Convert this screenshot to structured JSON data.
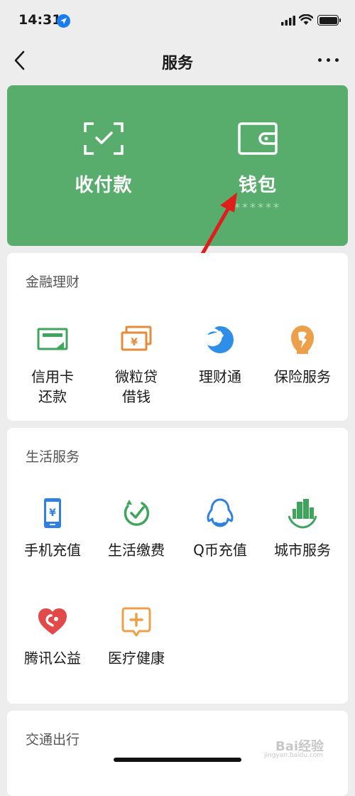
{
  "status_bar": {
    "time": "14:31"
  },
  "nav": {
    "title": "服务",
    "back_icon": "chevron-left-icon",
    "more_icon": "more-dots-icon"
  },
  "wallet_card": {
    "background": "#58ad6c",
    "items": [
      {
        "label": "收付款",
        "icon": "scan-check-icon"
      },
      {
        "label": "钱包",
        "sub": "******",
        "icon": "wallet-icon"
      }
    ]
  },
  "finance": {
    "title": "金融理财",
    "items": [
      {
        "label": "信用卡\n还款",
        "icon": "credit-card-icon"
      },
      {
        "label": "微粒贷\n借钱",
        "icon": "yuan-bills-icon"
      },
      {
        "label": "理财通",
        "icon": "licaitong-icon"
      },
      {
        "label": "保险服务",
        "icon": "insurance-umbrella-icon"
      }
    ]
  },
  "life": {
    "title": "生活服务",
    "items": [
      {
        "label": "手机充值",
        "icon": "phone-yuan-icon"
      },
      {
        "label": "生活缴费",
        "icon": "check-leaf-icon"
      },
      {
        "label": "Q币充值",
        "icon": "penguin-icon"
      },
      {
        "label": "城市服务",
        "icon": "city-buildings-icon"
      },
      {
        "label": "腾讯公益",
        "icon": "heart-icon"
      },
      {
        "label": "医疗健康",
        "icon": "medical-plus-icon"
      }
    ]
  },
  "transport": {
    "title": "交通出行"
  },
  "watermark": {
    "text": "Bai经验",
    "sub": "jingyan.baidu.com"
  }
}
